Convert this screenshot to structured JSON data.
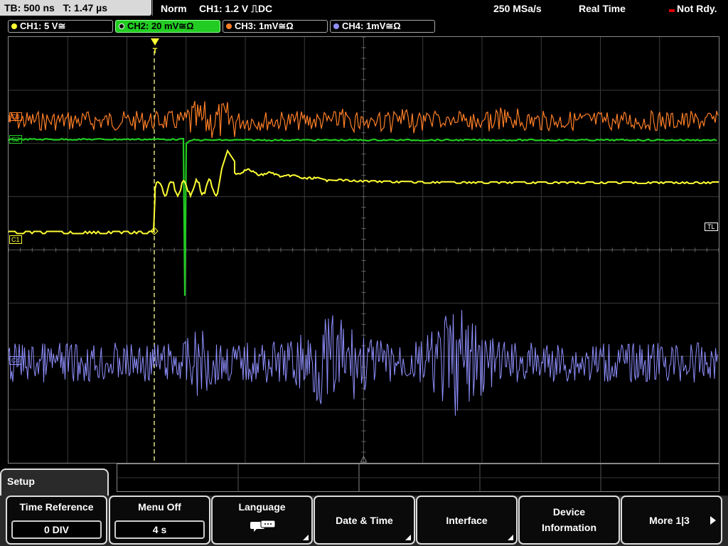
{
  "status": {
    "timebase": "TB: 500 ns",
    "trigger_time": "T: 1.47 µs",
    "acq_mode": "Norm",
    "trigger_info": "CH1: 1.2 V ⎍DC",
    "sample_rate": "250 MSa/s",
    "realtime": "Real Time",
    "ready": "Not Rdy."
  },
  "channels": [
    {
      "label": "CH1: 5 V≅",
      "color": "#ffff33"
    },
    {
      "label": "CH2: 20 mV≅Ω",
      "color": "#22cc22"
    },
    {
      "label": "CH3: 1mV≅Ω",
      "color": "#ff7f27"
    },
    {
      "label": "CH4: 1mV≅Ω",
      "color": "#8f8fff"
    }
  ],
  "markers": {
    "c1": "C1",
    "c2": "C2",
    "c3": "C3",
    "c4": "C4",
    "tl": "TL",
    "trigger": "T"
  },
  "menu": {
    "title": "Setup",
    "keys": [
      {
        "label": "Time Reference",
        "value": "0 DIV"
      },
      {
        "label": "Menu Off",
        "value": "4 s"
      },
      {
        "label": "Language",
        "value": ""
      },
      {
        "label": "Date & Time"
      },
      {
        "label": "Interface"
      },
      {
        "label": "Device",
        "label2": "Information"
      },
      {
        "label": "More 1|3"
      }
    ]
  }
}
